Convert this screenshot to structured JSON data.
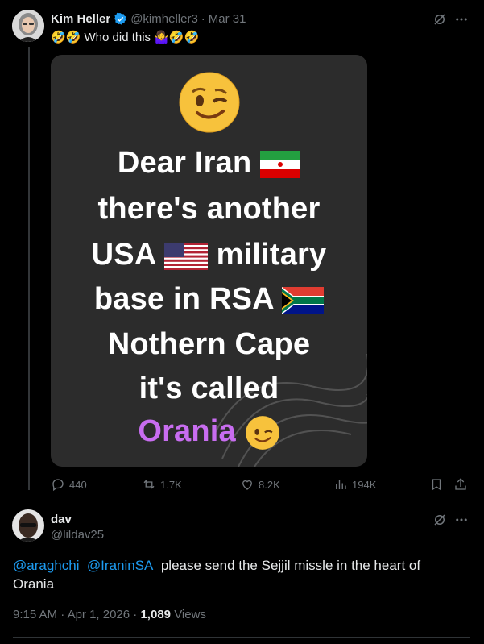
{
  "tweet": {
    "author_name": "Kim Heller",
    "handle": "@kimheller3",
    "date": "Mar 31",
    "text": "🤣🤣 Who did this 🤷‍♀️🤣🤣",
    "media": {
      "top_emoji": "😉",
      "lines": [
        "Dear Iran",
        "there's another",
        "USA",
        "military",
        "base in RSA",
        "Nothern Cape",
        "it's called",
        "Orania"
      ],
      "end_emoji": "😉"
    },
    "actions": {
      "replies": "440",
      "reposts": "1.7K",
      "likes": "8.2K",
      "views": "194K"
    }
  },
  "reply": {
    "author_name": "dav",
    "handle": "@lildav25",
    "mention1": "@araghchi",
    "mention2": "@IraninSA",
    "text": "please send the Sejjil missle  in the heart  of Orania",
    "time": "9:15 AM",
    "date": "Apr 1, 2026",
    "views_count": "1,089",
    "views_label": "Views"
  },
  "colors": {
    "background": "#000000",
    "accent": "#1d9bf0",
    "muted": "#71767b",
    "orania": "#c86df0"
  }
}
